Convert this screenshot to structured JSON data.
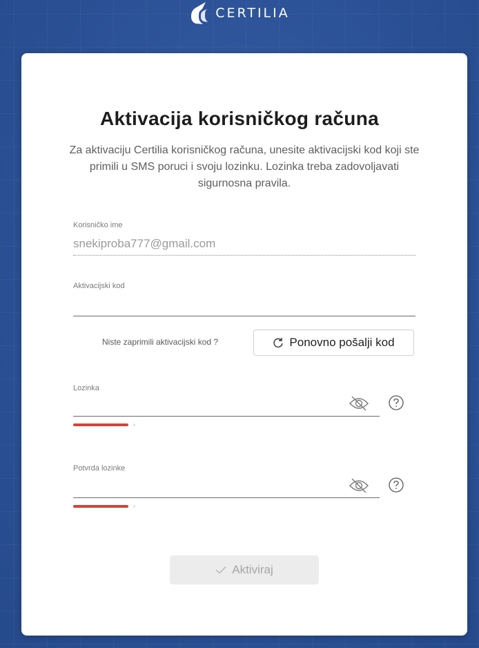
{
  "brand": {
    "name": "CERTILIA",
    "accent": "#2a4f93",
    "logo_icon": "certilia-logo-icon"
  },
  "page": {
    "title": "Aktivacija korisničkog računa",
    "subtitle": "Za aktivaciju Certilia korisničkog računa, unesite aktivacijski kod koji ste primili u SMS poruci i svoju lozinku. Lozinka treba zadovoljavati sigurnosna pravila."
  },
  "username": {
    "label": "Korisničko ime",
    "value": "snekiproba777@gmail.com"
  },
  "activation_code": {
    "label": "Aktivacijski kod",
    "value": ""
  },
  "resend": {
    "prompt": "Niste zaprimili aktivacijski kod ?",
    "button_label": "Ponovno pošalji kod",
    "icon": "refresh-icon"
  },
  "password": {
    "label": "Lozinka",
    "value": "",
    "toggle_icon": "eye-off-icon",
    "help_icon": "question-circle-icon"
  },
  "password_confirm": {
    "label": "Potvrda lozinke",
    "value": "",
    "toggle_icon": "eye-off-icon",
    "help_icon": "question-circle-icon"
  },
  "strength": {
    "color": "#d9413a"
  },
  "submit": {
    "label": "Aktiviraj",
    "icon": "check-icon",
    "disabled": true
  }
}
